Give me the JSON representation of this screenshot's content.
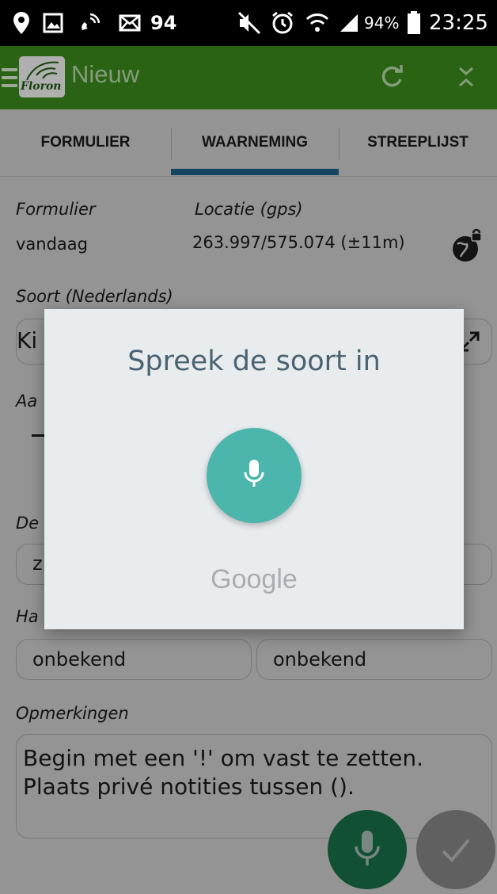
{
  "status_bar": {
    "notification_count": "94",
    "battery_percent": "94%",
    "time": "23:25"
  },
  "app_bar": {
    "logo_text": "Floron",
    "title": "Nieuw",
    "color": "#3b8a1c"
  },
  "tabs": [
    {
      "label": "FORMULIER",
      "active": false
    },
    {
      "label": "WAARNEMING",
      "active": true
    },
    {
      "label": "STREEPLIJST",
      "active": false
    }
  ],
  "tab_indicator_color": "#2177a8",
  "form": {
    "formulier_label": "Formulier",
    "formulier_value": "vandaag",
    "locatie_label": "Locatie (gps)",
    "locatie_value": "263.997/575.074 (±11m)",
    "soort_label": "Soort (Nederlands)",
    "soort_value": "Ki",
    "aantal_label": "Aa",
    "detail_label": "De",
    "detail_value": "z",
    "hab_label": "Ha",
    "hab_value_1": "onbekend",
    "hab_value_2": "onbekend",
    "opmerkingen_label": "Opmerkingen",
    "opmerkingen_placeholder_line1": "Begin met een '!' om vast te zetten.",
    "opmerkingen_placeholder_line2": "Plaats privé notities tussen ()."
  },
  "dialog": {
    "title": "Spreek de soort in",
    "brand": "Google",
    "mic_color": "#4db6ac"
  },
  "icons": {
    "menu": "menu-icon",
    "refresh": "refresh-icon",
    "close": "close-icon",
    "globe": "globe-lock-icon",
    "microphone": "microphone-icon",
    "check": "check-icon"
  }
}
